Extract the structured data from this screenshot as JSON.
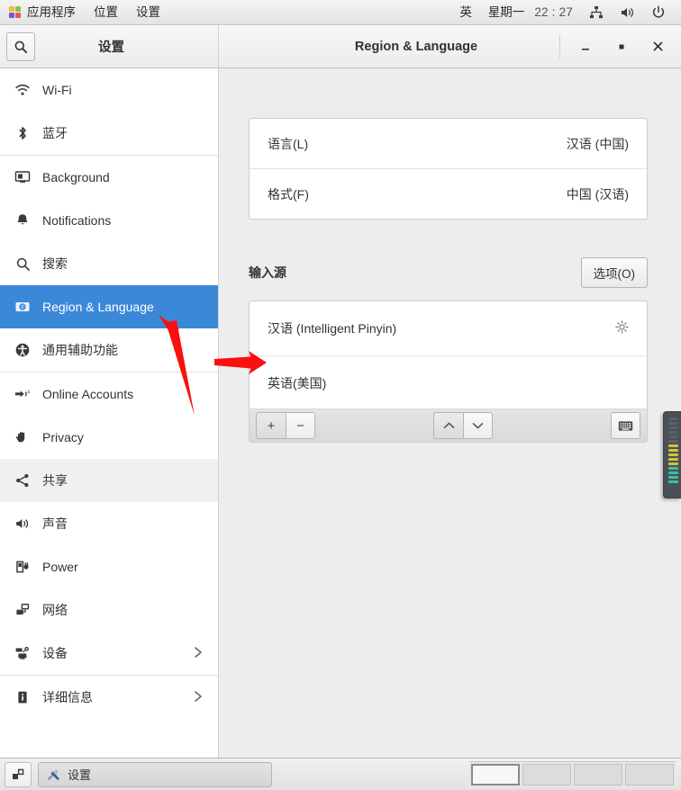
{
  "top_panel": {
    "menus": [
      {
        "label": "应用程序",
        "icon": "applications-icon"
      },
      {
        "label": "位置",
        "icon": null
      },
      {
        "label": "设置",
        "icon": null
      }
    ],
    "ime_indicator": "英",
    "weekday": "星期一",
    "clock": "22 : 27",
    "tray_icons": [
      "network-icon",
      "volume-icon",
      "power-icon"
    ]
  },
  "sidebar": {
    "title": "设置",
    "search_icon": "search-icon",
    "items": [
      {
        "label": "Wi-Fi",
        "icon": "wifi-icon",
        "selected": false,
        "hover": false,
        "chevron": false,
        "sep_after": false
      },
      {
        "label": "蓝牙",
        "icon": "bluetooth-icon",
        "selected": false,
        "hover": false,
        "chevron": false,
        "sep_after": true
      },
      {
        "label": "Background",
        "icon": "background-icon",
        "selected": false,
        "hover": false,
        "chevron": false,
        "sep_after": false
      },
      {
        "label": "Notifications",
        "icon": "bell-icon",
        "selected": false,
        "hover": false,
        "chevron": false,
        "sep_after": false
      },
      {
        "label": "搜索",
        "icon": "search-icon",
        "selected": false,
        "hover": false,
        "chevron": false,
        "sep_after": false
      },
      {
        "label": "Region & Language",
        "icon": "region-language-icon",
        "selected": true,
        "hover": false,
        "chevron": false,
        "sep_after": false
      },
      {
        "label": "通用辅助功能",
        "icon": "accessibility-icon",
        "selected": false,
        "hover": false,
        "chevron": false,
        "sep_after": true
      },
      {
        "label": "Online Accounts",
        "icon": "online-accounts-icon",
        "selected": false,
        "hover": false,
        "chevron": false,
        "sep_after": false
      },
      {
        "label": "Privacy",
        "icon": "privacy-hand-icon",
        "selected": false,
        "hover": false,
        "chevron": false,
        "sep_after": false
      },
      {
        "label": "共享",
        "icon": "sharing-icon",
        "selected": false,
        "hover": true,
        "chevron": false,
        "sep_after": false
      },
      {
        "label": "声音",
        "icon": "sound-icon",
        "selected": false,
        "hover": false,
        "chevron": false,
        "sep_after": false
      },
      {
        "label": "Power",
        "icon": "power-plug-icon",
        "selected": false,
        "hover": false,
        "chevron": false,
        "sep_after": false
      },
      {
        "label": "网络",
        "icon": "network-icon",
        "selected": false,
        "hover": false,
        "chevron": false,
        "sep_after": false
      },
      {
        "label": "设备",
        "icon": "devices-icon",
        "selected": false,
        "hover": false,
        "chevron": true,
        "sep_after": true
      },
      {
        "label": "详细信息",
        "icon": "info-icon",
        "selected": false,
        "hover": false,
        "chevron": true,
        "sep_after": false
      }
    ]
  },
  "window": {
    "title": "Region & Language",
    "controls": {
      "minimize": "minimize-icon",
      "maximize": "maximize-icon",
      "close": "close-icon"
    }
  },
  "main": {
    "language_rows": [
      {
        "label": "语言(L)",
        "value": "汉语 (中国)"
      },
      {
        "label": "格式(F)",
        "value": "中国 (汉语)"
      }
    ],
    "input_sources": {
      "title": "输入源",
      "options_button": "选项(O)",
      "rows": [
        {
          "label": "汉语 (Intelligent Pinyin)",
          "has_gear": true
        },
        {
          "label": "英语(美国)",
          "has_gear": false
        }
      ],
      "toolbar": {
        "add": "+",
        "remove": "−",
        "move_up": "move-up-icon",
        "move_down": "move-down-icon",
        "keyboard_preview": "keyboard-icon"
      }
    }
  },
  "vu_widget": {
    "name": "level-meter-widget",
    "bars": [
      "#5a6068",
      "#5a6068",
      "#5a6068",
      "#5a6068",
      "#5a6068",
      "#5a6068",
      "#d4c23a",
      "#d4c23a",
      "#d4c23a",
      "#d4c23a",
      "#d4c23a",
      "#3fbfa0",
      "#3fbfa0",
      "#3fbfa0",
      "#3fbfa0"
    ]
  },
  "bottom_panel": {
    "show_desktop": "show-desktop-icon",
    "tasks": [
      {
        "label": "设置",
        "icon": "tools-icon",
        "active": true
      }
    ],
    "workspaces": [
      {
        "active": true
      },
      {
        "active": false
      },
      {
        "active": false
      },
      {
        "active": false
      }
    ]
  },
  "annotations": {
    "arrow_color": "#fb0f0f",
    "arrows": [
      {
        "name": "arrow-to-region-language",
        "from": [
          215,
          460
        ],
        "to": [
          178,
          352
        ]
      },
      {
        "name": "arrow-to-english-us",
        "from": [
          238,
          403
        ],
        "to": [
          290,
          403
        ]
      }
    ]
  }
}
